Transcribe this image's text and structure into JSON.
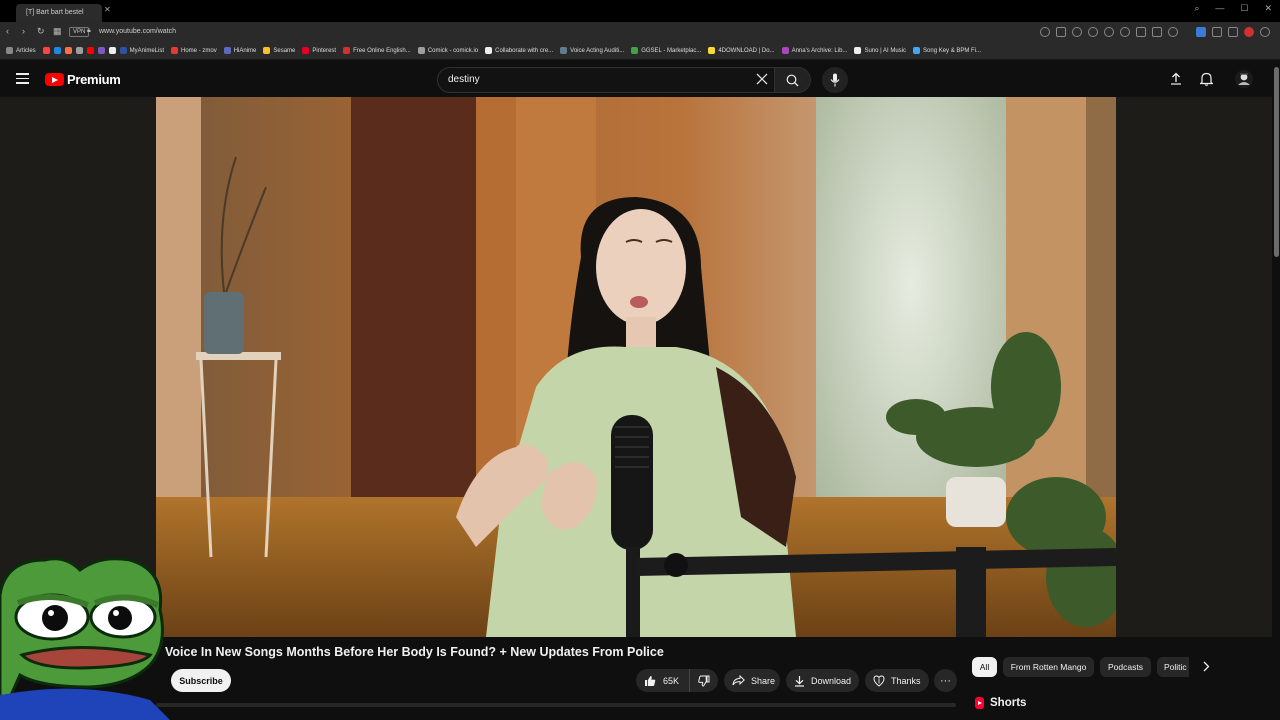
{
  "browser": {
    "tab_title": "[T] Bart bart bestel",
    "url": "www.youtube.com/watch",
    "vpn_label": "VPN",
    "bookmarks": [
      {
        "label": "Articles",
        "color": "#888888"
      },
      {
        "label": "",
        "color": "#ff4444"
      },
      {
        "label": "",
        "color": "#1e88e5"
      },
      {
        "label": "",
        "color": "#ff7043"
      },
      {
        "label": "",
        "color": "#9e9e9e"
      },
      {
        "label": "",
        "color": "#ff0000"
      },
      {
        "label": "",
        "color": "#7e57c2"
      },
      {
        "label": "",
        "color": "#eeeeee"
      },
      {
        "label": "MyAnimeList",
        "color": "#2e51a2"
      },
      {
        "label": "Home - zmov",
        "color": "#e53935"
      },
      {
        "label": "HiAnime",
        "color": "#5c6bc0"
      },
      {
        "label": "Sesame",
        "color": "#fbc02d"
      },
      {
        "label": "Pinterest",
        "color": "#e60023"
      },
      {
        "label": "Free Online English...",
        "color": "#d32f2f"
      },
      {
        "label": "Comick - comick.io",
        "color": "#9e9e9e"
      },
      {
        "label": "Collaborate with cre...",
        "color": "#eeeeee"
      },
      {
        "label": "Voice Acting Auditi...",
        "color": "#607d8b"
      },
      {
        "label": "GGSEL - Marketplac...",
        "color": "#43a047"
      },
      {
        "label": "4DOWNLOAD | Do...",
        "color": "#fdd835"
      },
      {
        "label": "Anna's Archive: Lib...",
        "color": "#ab47bc"
      },
      {
        "label": "Suno | AI Music",
        "color": "#eeeeee"
      },
      {
        "label": "Song Key & BPM Fi...",
        "color": "#42a5f5"
      }
    ]
  },
  "youtube": {
    "logo_text": "Premium",
    "search_value": "destiny",
    "video_title": "Voice In New Songs Months Before Her Body Is Found? + New Updates From Police",
    "subscribe_label": "Subscribe",
    "like_count": "65K",
    "share_label": "Share",
    "download_label": "Download",
    "thanks_label": "Thanks",
    "more_label": "···",
    "chips": [
      "All",
      "From Rotten Mango",
      "Podcasts",
      "Politic"
    ],
    "shorts_label": "Shorts"
  },
  "colors": {
    "brand_red": "#ff0000",
    "background": "#0f0f0f",
    "pill_bg": "#272727"
  }
}
